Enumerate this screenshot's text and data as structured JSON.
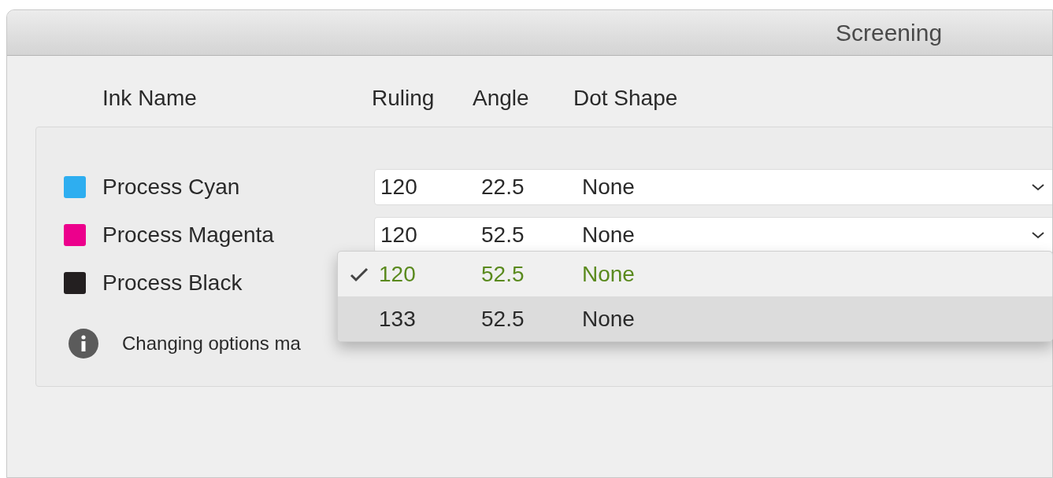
{
  "window": {
    "title": "Screening"
  },
  "columns": [
    "Ink Name",
    "Ruling",
    "Angle",
    "Dot Shape"
  ],
  "inks": [
    {
      "name": "Process Cyan",
      "color": "#2eaef0",
      "screening": {
        "ruling": "120",
        "angle": "22.5",
        "dot_shape": "None"
      }
    },
    {
      "name": "Process Magenta",
      "color": "#ec008c",
      "screening": {
        "ruling": "120",
        "angle": "52.5",
        "dot_shape": "None"
      }
    },
    {
      "name": "Process Black",
      "color": "#231f20"
    }
  ],
  "info": "Changing options ma",
  "menu": {
    "items": [
      {
        "ruling": "120",
        "angle": "52.5",
        "dot_shape": "None",
        "checked": true,
        "selected": false
      },
      {
        "ruling": "133",
        "angle": "52.5",
        "dot_shape": "None",
        "checked": false,
        "selected": true
      }
    ]
  }
}
